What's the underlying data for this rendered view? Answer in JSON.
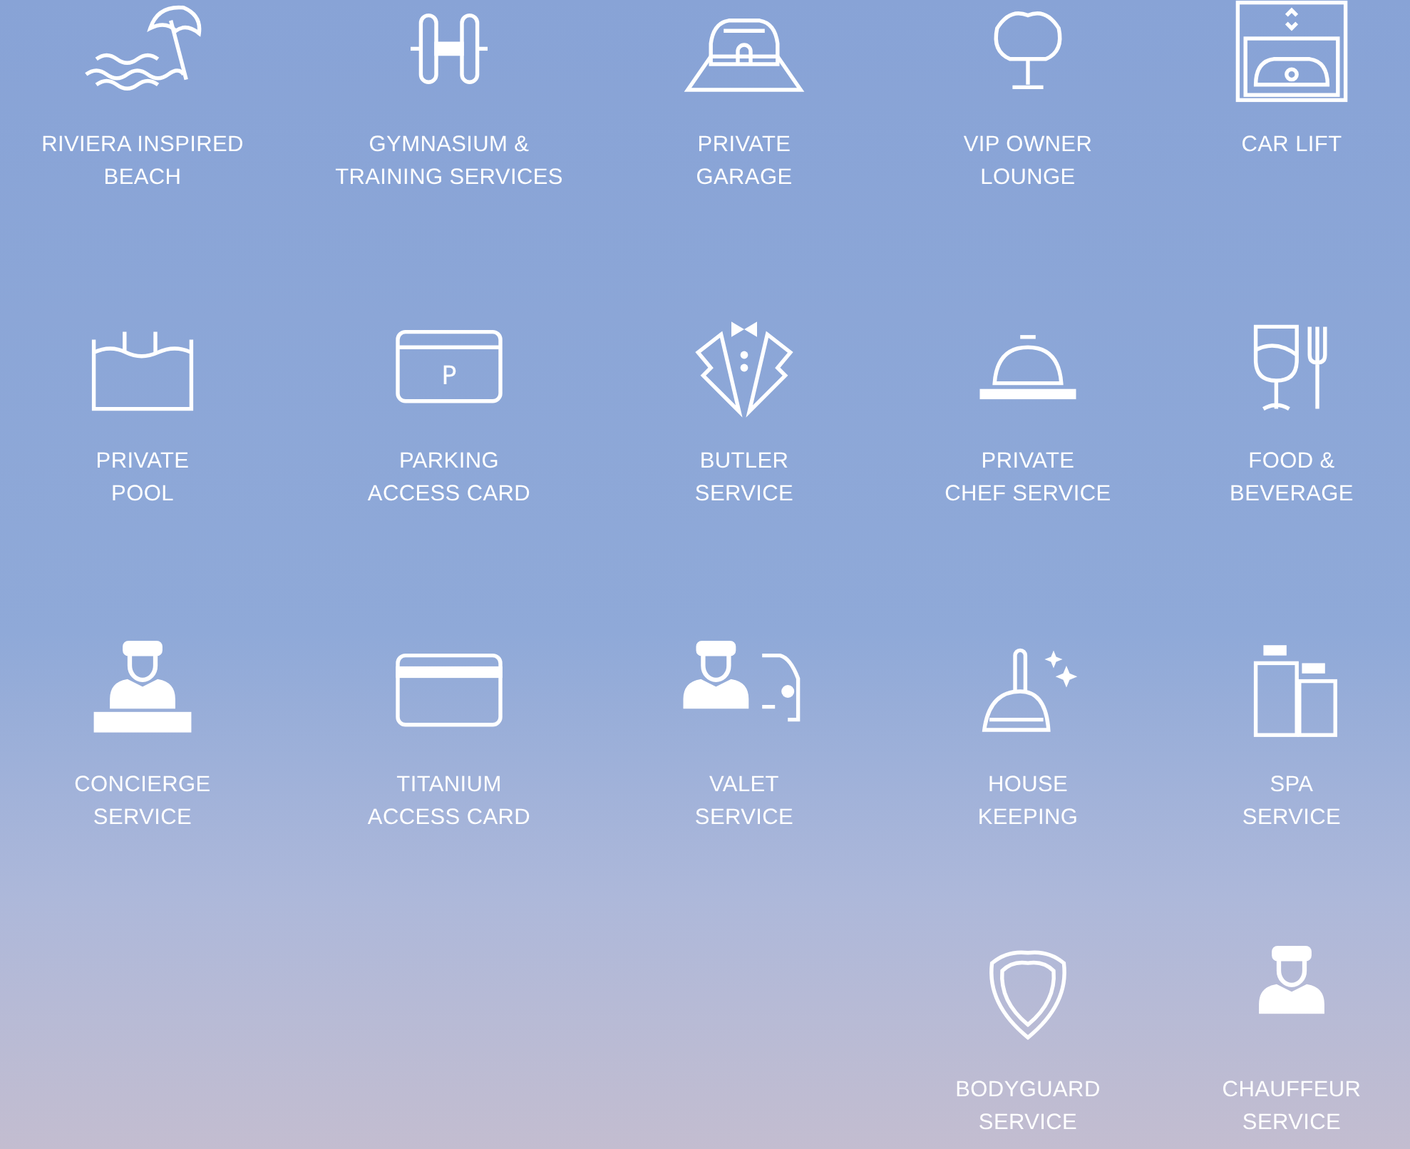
{
  "amenities": [
    {
      "kind": "beach",
      "label_lines": [
        "RIVIERA INSPIRED",
        "BEACH"
      ]
    },
    {
      "kind": "dumbbell",
      "label_lines": [
        "GYMNASIUM &",
        "TRAINING SERVICES"
      ]
    },
    {
      "kind": "garage",
      "label_lines": [
        "PRIVATE",
        "GARAGE"
      ]
    },
    {
      "kind": "chair",
      "label_lines": [
        "VIP OWNER",
        "LOUNGE"
      ]
    },
    {
      "kind": "carlift",
      "label_lines": [
        "CAR LIFT"
      ]
    },
    {
      "kind": "pool",
      "label_lines": [
        "PRIVATE",
        "POOL"
      ]
    },
    {
      "kind": "parking",
      "icon_text": "P",
      "label_lines": [
        "PARKING",
        "ACCESS CARD"
      ]
    },
    {
      "kind": "tuxedo",
      "label_lines": [
        "BUTLER",
        "SERVICE"
      ]
    },
    {
      "kind": "cloche",
      "label_lines": [
        "PRIVATE",
        "CHEF SERVICE"
      ]
    },
    {
      "kind": "dining",
      "label_lines": [
        "FOOD &",
        "BEVERAGE"
      ]
    },
    {
      "kind": "concierge",
      "label_lines": [
        "CONCIERGE",
        "SERVICE"
      ]
    },
    {
      "kind": "card",
      "label_lines": [
        "TITANIUM",
        "ACCESS CARD"
      ]
    },
    {
      "kind": "valet",
      "label_lines": [
        "VALET",
        "SERVICE"
      ]
    },
    {
      "kind": "dustpan",
      "label_lines": [
        "HOUSE",
        "KEEPING"
      ]
    },
    {
      "kind": "bottles",
      "label_lines": [
        "SPA",
        "SERVICE"
      ]
    },
    {
      "kind": "shield",
      "label_lines": [
        "BODYGUARD",
        "SERVICE"
      ]
    },
    {
      "kind": "chauffeur",
      "label_lines": [
        "CHAUFFEUR",
        "SERVICE"
      ]
    }
  ]
}
